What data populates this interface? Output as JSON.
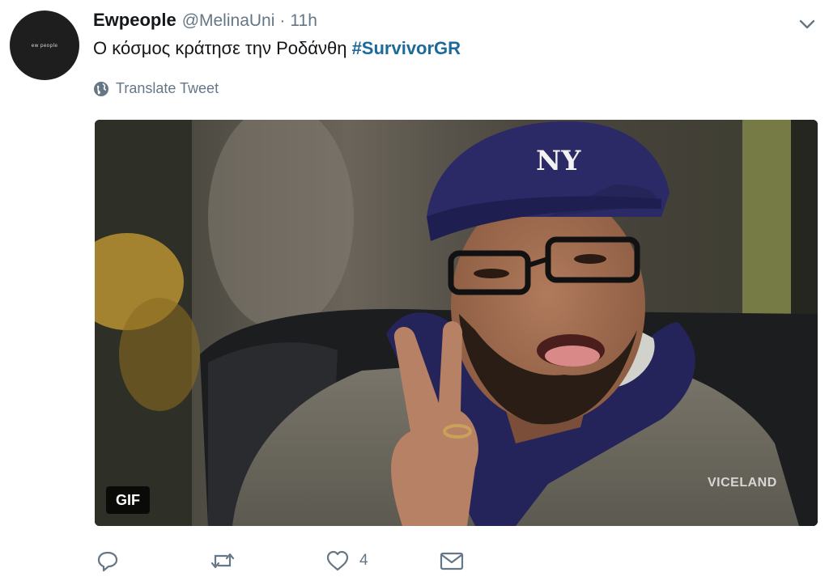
{
  "tweet": {
    "avatar_text": "ew people",
    "display_name": "Ewpeople",
    "handle": "@MelinaUni",
    "separator": "·",
    "time": "11h",
    "text": "Ο κόσμος κράτησε την Ροδάνθη ",
    "hashtag": "#SurvivorGR",
    "translate_label": "Translate Tweet"
  },
  "media": {
    "badge": "GIF",
    "watermark": "VICELAND",
    "cap_logo": "NY"
  },
  "actions": {
    "reply_icon": "reply-icon",
    "retweet_icon": "retweet-icon",
    "like_icon": "heart-icon",
    "like_count": "4",
    "dm_icon": "envelope-icon"
  },
  "colors": {
    "hashtag": "#1b6a9a",
    "muted": "#657786",
    "text": "#14171a"
  }
}
